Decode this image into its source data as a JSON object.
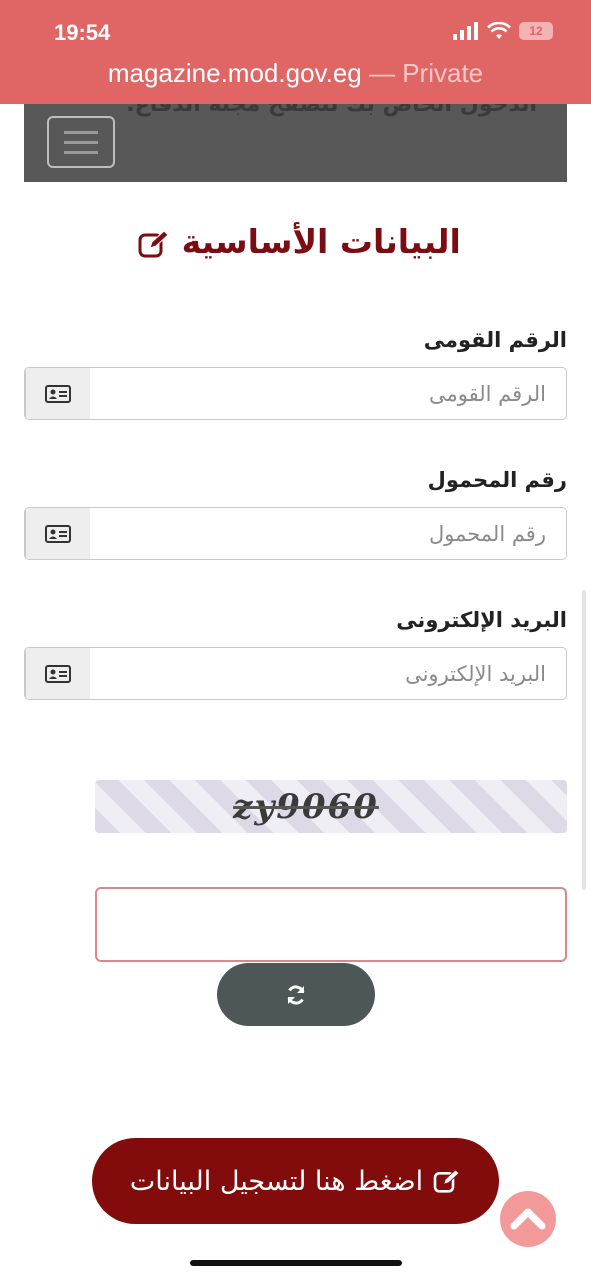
{
  "status_bar": {
    "time": "19:54",
    "battery": "12",
    "url_host": "magazine.mod.gov.eg",
    "url_private": "— Private"
  },
  "navbar": {
    "cut_text": "الدخول الخاص بك لتصفح مجلة الدفاع."
  },
  "form": {
    "title": "البيانات الأساسية",
    "national_id": {
      "label": "الرقم القومى",
      "placeholder": "الرقم القومى",
      "value": ""
    },
    "mobile": {
      "label": "رقم المحمول",
      "placeholder": "رقم المحمول",
      "value": ""
    },
    "email": {
      "label": "البريد الإلكترونى",
      "placeholder": "البريد الإلكترونى",
      "value": ""
    },
    "captcha": {
      "text": "zy9060",
      "input_value": ""
    },
    "submit_label": "اضغط هنا لتسجيل البيانات"
  },
  "colors": {
    "status_bar": "#e06666",
    "title": "#7a0c12",
    "submit": "#820c0c",
    "refresh": "#4d5757",
    "scroll_top": "#f29a9a"
  },
  "icons": {
    "edit": "pencil-square-icon",
    "id_card": "id-card-icon",
    "refresh": "refresh-icon",
    "scroll_top": "chevron-up-icon"
  }
}
